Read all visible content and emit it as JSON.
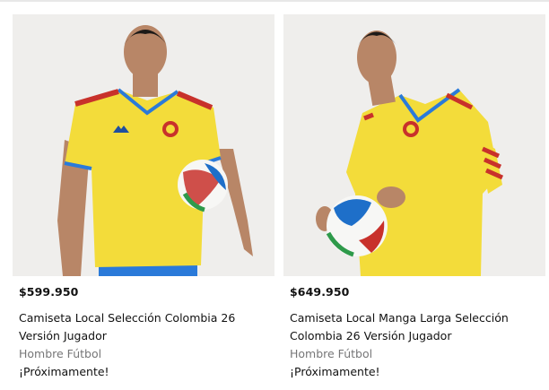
{
  "products": [
    {
      "price": "$599.950",
      "title": "Camiseta Local Selección Colombia 26 Versión Jugador",
      "category": "Hombre Fútbol",
      "status": "¡Próximamente!",
      "image_alt": "Jugador con camiseta amarilla de manga corta sosteniendo un balón"
    },
    {
      "price": "$649.950",
      "title": "Camiseta Local Manga Larga Selección Colombia 26 Versión Jugador",
      "category": "Hombre Fútbol",
      "status": "¡Próximamente!",
      "image_alt": "Jugador con camiseta amarilla de manga larga sosteniendo un balón"
    }
  ],
  "colors": {
    "jersey_yellow": "#f3dc3a",
    "trim_red": "#c8312b",
    "shorts_blue": "#2a7ad9",
    "background": "#efeeec",
    "muted_text": "#767677"
  }
}
